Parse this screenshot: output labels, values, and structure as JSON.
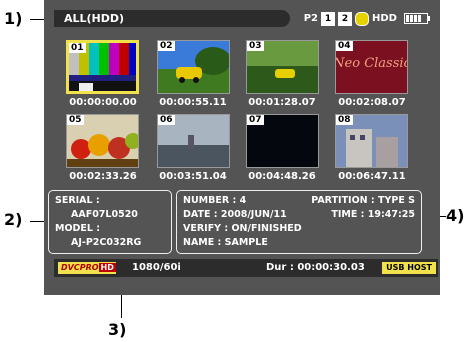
{
  "callouts": [
    "1)",
    "2)",
    "3)",
    "4)"
  ],
  "header": {
    "source_label": "ALL(HDD)",
    "card_label": "P2",
    "slots": [
      "1",
      "2"
    ],
    "hdd_label": "HDD",
    "icons": [
      "hdd-icon",
      "battery-icon"
    ]
  },
  "thumbnails": [
    {
      "number": "01",
      "timecode": "00:00:00.00",
      "selected": true
    },
    {
      "number": "02",
      "timecode": "00:00:55.11",
      "selected": false
    },
    {
      "number": "03",
      "timecode": "00:01:28.07",
      "selected": false
    },
    {
      "number": "04",
      "timecode": "00:02:08.07",
      "selected": false,
      "overlay_text": "Neo Classic"
    },
    {
      "number": "05",
      "timecode": "00:02:33.26",
      "selected": false
    },
    {
      "number": "06",
      "timecode": "00:03:51.04",
      "selected": false
    },
    {
      "number": "07",
      "timecode": "00:04:48.26",
      "selected": false
    },
    {
      "number": "08",
      "timecode": "00:06:47.11",
      "selected": false
    }
  ],
  "device_info": {
    "serial_label": "SERIAL :",
    "serial_value": "AAF07L0520",
    "model_label": "MODEL :",
    "model_value": "AJ-P2C032RG"
  },
  "clip_info": {
    "number": "NUMBER : 4",
    "partition": "PARTITION : TYPE S",
    "date": "DATE : 2008/JUN/11",
    "time": "TIME : 19:47:25",
    "verify": "VERIFY : ON/FINISHED",
    "name": "NAME : SAMPLE"
  },
  "footer": {
    "codec": "DVCPRO",
    "codec_hd": "HD",
    "format": "1080/60i",
    "duration": "Dur : 00:00:30.03",
    "usb": "USB HOST"
  },
  "colors": {
    "screen_bg": "#545454",
    "bar_bg": "#2c2c2c",
    "select_yellow": "#f1e14a"
  }
}
